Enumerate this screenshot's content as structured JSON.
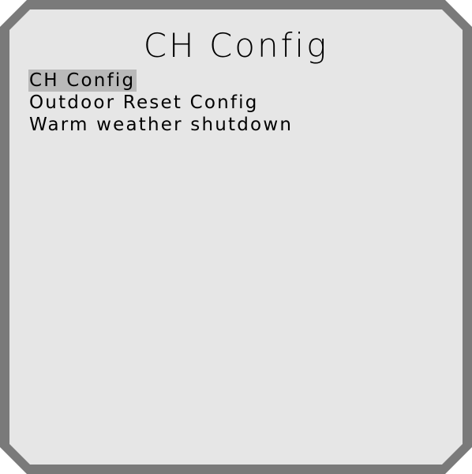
{
  "screen": {
    "title": "CH Config"
  },
  "menu": {
    "items": [
      {
        "label": "CH Config",
        "selected": true
      },
      {
        "label": "Outdoor Reset Config",
        "selected": false
      },
      {
        "label": "Warm weather shutdown",
        "selected": false
      }
    ]
  },
  "colors": {
    "bezel": "#7a7a7a",
    "screen_background": "#e6e6e6",
    "selection_highlight": "#b9b9b9",
    "text": "#000000"
  }
}
